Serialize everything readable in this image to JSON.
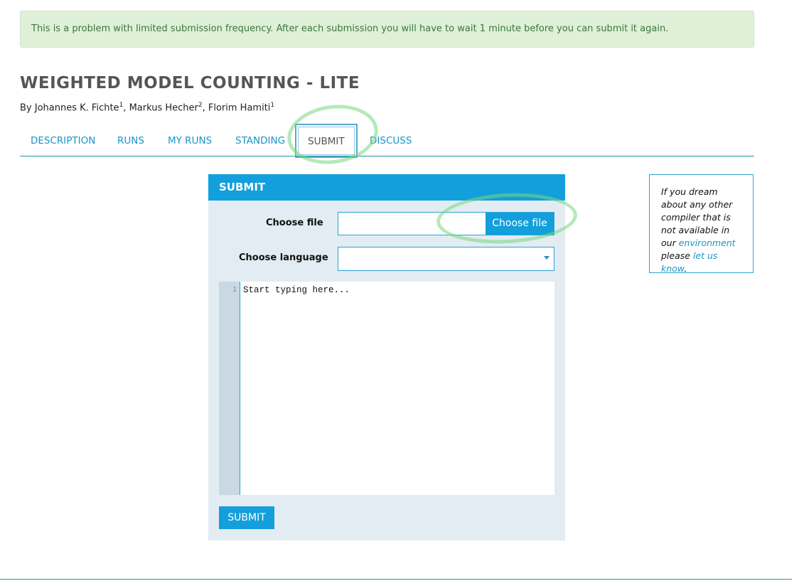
{
  "alert": {
    "text": "This is a problem with limited submission frequency. After each submission you will have to wait 1 minute before you can submit it again."
  },
  "problem": {
    "title": "WEIGHTED MODEL COUNTING - LITE",
    "authors_prefix": "By",
    "authors": [
      {
        "name": "Johannes K. Fichte",
        "sup": "1",
        "sep": ", "
      },
      {
        "name": "Markus Hecher",
        "sup": "2",
        "sep": ", "
      },
      {
        "name": "Florim Hamiti",
        "sup": "1",
        "sep": ""
      }
    ]
  },
  "tabs": [
    {
      "label": "DESCRIPTION"
    },
    {
      "label": "RUNS"
    },
    {
      "label": "MY RUNS"
    },
    {
      "label": "STANDING"
    },
    {
      "label": "SUBMIT",
      "active": true
    },
    {
      "label": "DISCUSS"
    }
  ],
  "submit_panel": {
    "header": "SUBMIT",
    "choose_file_label": "Choose file",
    "choose_file_button": "Choose file",
    "choose_language_label": "Choose language",
    "language_value": "",
    "editor_line_number": "1",
    "editor_placeholder": "Start typing here...",
    "submit_button": "SUBMIT"
  },
  "side_note": {
    "text_before": "If you dream about any other compiler that is not available in our",
    "link_environment": "environment",
    "text_middle": "please",
    "link_let_us_know": "let us know",
    "text_after": "."
  },
  "colors": {
    "accent": "#129fdc",
    "alert_bg": "#dff0d8",
    "alert_text": "#3c763d",
    "panel_bg": "#e2ecf2",
    "highlight_mark": "#78d782"
  }
}
